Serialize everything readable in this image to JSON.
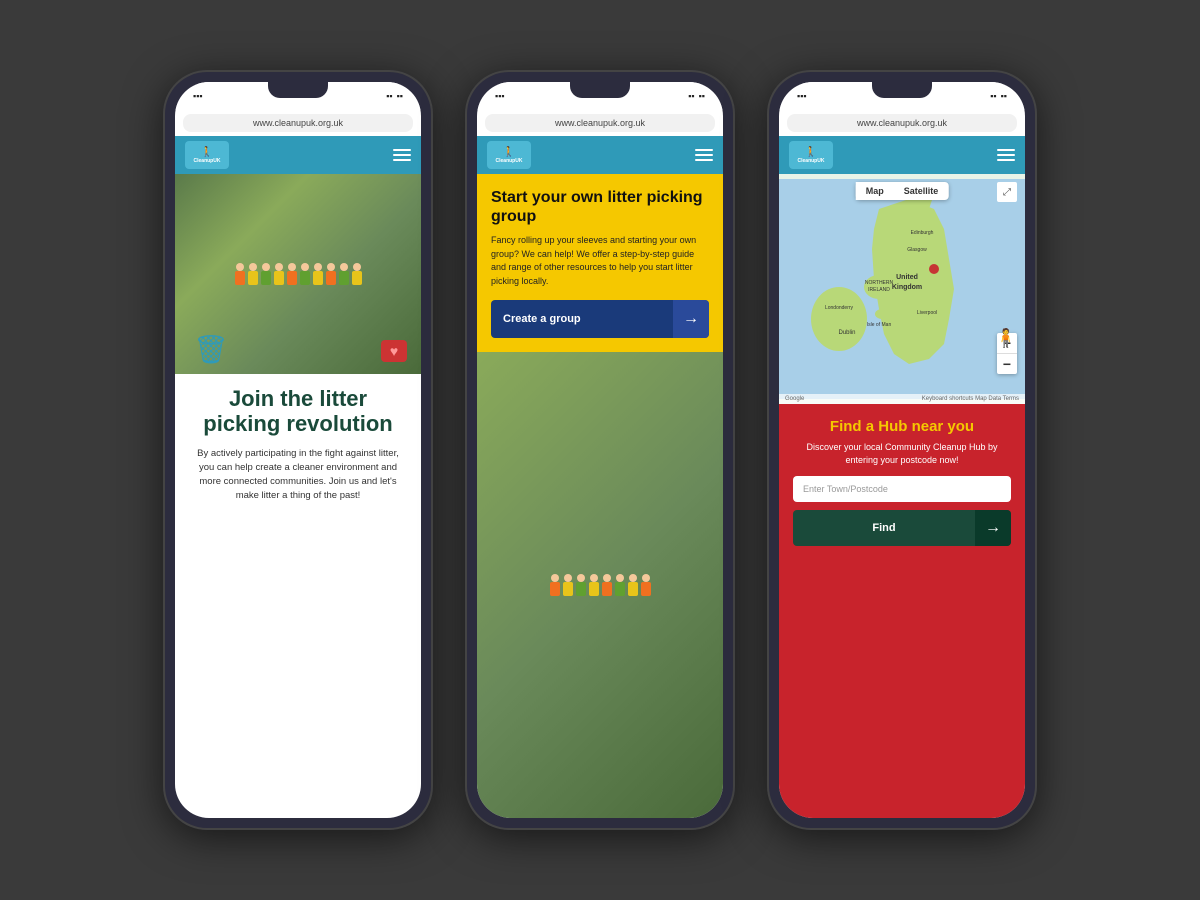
{
  "page": {
    "background": "#3a3a3a"
  },
  "phones": [
    {
      "id": "phone1",
      "status": {
        "signal": "▪▪▪",
        "wifi": "wifi",
        "battery": "▪▪▪"
      },
      "url": "www.cleanupuk.org.uk",
      "nav": {
        "logo_text": "CleanupUK",
        "menu_label": "hamburger menu"
      },
      "hero": {
        "trash_icon": "🗑",
        "heart_icon": "♥"
      },
      "headline": "Join the litter picking revolution",
      "body": "By actively participating in the fight against litter, you can help create a cleaner environment and more connected communities. Join us and let's make litter a thing of the past!"
    },
    {
      "id": "phone2",
      "url": "www.cleanupuk.org.uk",
      "nav": {
        "logo_text": "CleanupUK"
      },
      "yellow_section": {
        "headline": "Start your own litter picking group",
        "body": "Fancy rolling up your sleeves and starting your own group? We can help! We offer a step-by-step guide and range of other resources to help you start litter picking locally.",
        "button_label": "Create a group",
        "button_arrow": "→"
      }
    },
    {
      "id": "phone3",
      "url": "www.cleanupuk.org.uk",
      "nav": {
        "logo_text": "CleanupUK"
      },
      "map": {
        "tab_map": "Map",
        "tab_satellite": "Satellite",
        "expand_icon": "⤢",
        "zoom_in": "+",
        "zoom_out": "−",
        "credits": "Google",
        "credits_right": "Keyboard shortcuts  Map Data  Terms"
      },
      "red_section": {
        "headline": "Find a Hub near you",
        "body": "Discover your local Community Cleanup Hub by entering your postcode now!",
        "input_placeholder": "Enter Town/Postcode",
        "button_label": "Find",
        "button_arrow": "→"
      }
    }
  ]
}
